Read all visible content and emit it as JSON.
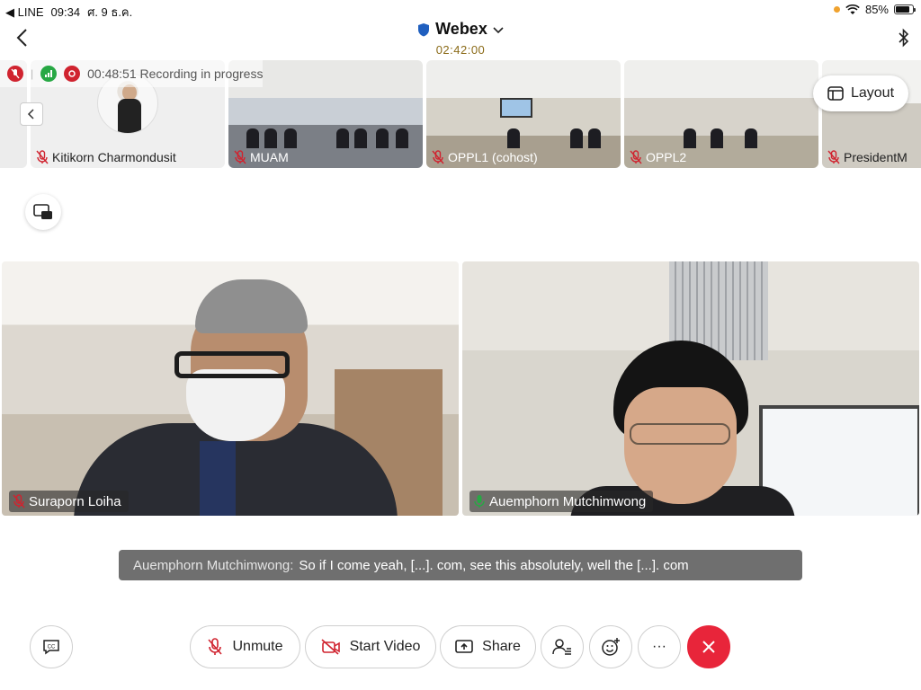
{
  "status_bar": {
    "back_app": "◀ LINE",
    "time": "09:34",
    "date": "ศ. 9 ธ.ค.",
    "battery": "85%",
    "battery_level": 0.85
  },
  "header": {
    "title": "Webex",
    "timer": "02:42:00"
  },
  "recording": {
    "text": "00:48:51 Recording in progress"
  },
  "strip": {
    "participants": [
      {
        "name": "Kitikorn Charmondusit"
      },
      {
        "name": "MUAM"
      },
      {
        "name": "OPPL1 (cohost)"
      },
      {
        "name": "OPPL2"
      },
      {
        "name": "PresidentM"
      }
    ],
    "layout_label": "Layout"
  },
  "videos": [
    {
      "name": "Suraporn Loiha"
    },
    {
      "name": "Auemphorn Mutchimwong"
    }
  ],
  "caption": {
    "speaker": "Auemphorn Mutchimwong:",
    "text": "So if I come yeah, [...]. com, see this absolutely, well the [...]. com"
  },
  "controls": {
    "unmute": "Unmute",
    "start_video": "Start Video",
    "share": "Share",
    "more": "···"
  },
  "colors": {
    "leave": "#e8253a",
    "muted_icon": "#d0232f",
    "timer": "#8a6a17"
  }
}
